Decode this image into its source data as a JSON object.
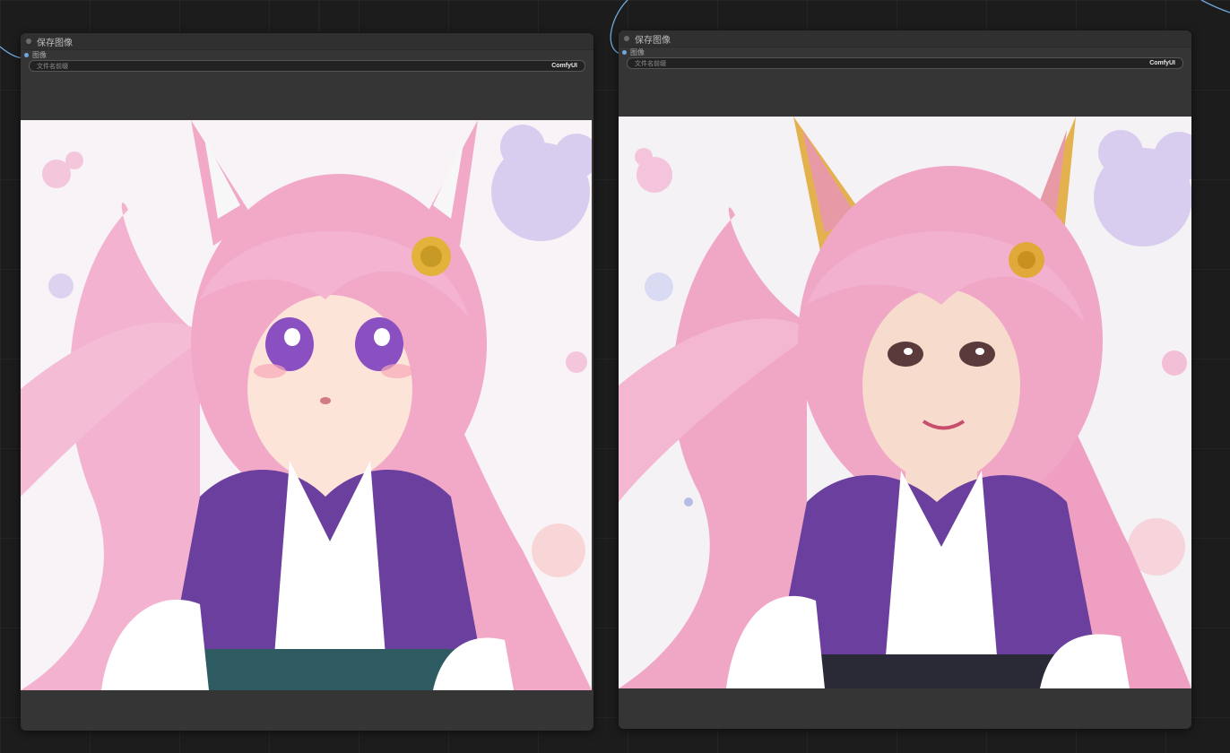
{
  "nodes": [
    {
      "title": "保存图像",
      "input_label": "图像",
      "widget": {
        "label": "文件名前缀",
        "value": "ComfyUI"
      },
      "image_semantic": "anime-style pink-haired fox-ear girl"
    },
    {
      "title": "保存图像",
      "input_label": "图像",
      "widget": {
        "label": "文件名前缀",
        "value": "ComfyUI"
      },
      "image_semantic": "realistic-style pink-haired fox-ear girl"
    }
  ],
  "colors": {
    "canvas_bg": "#1c1c1c",
    "node_bg": "#353535",
    "wire": "#6fa8dc",
    "hair_pink": "#f2a9c8",
    "robe_purple": "#6a3f9e"
  }
}
